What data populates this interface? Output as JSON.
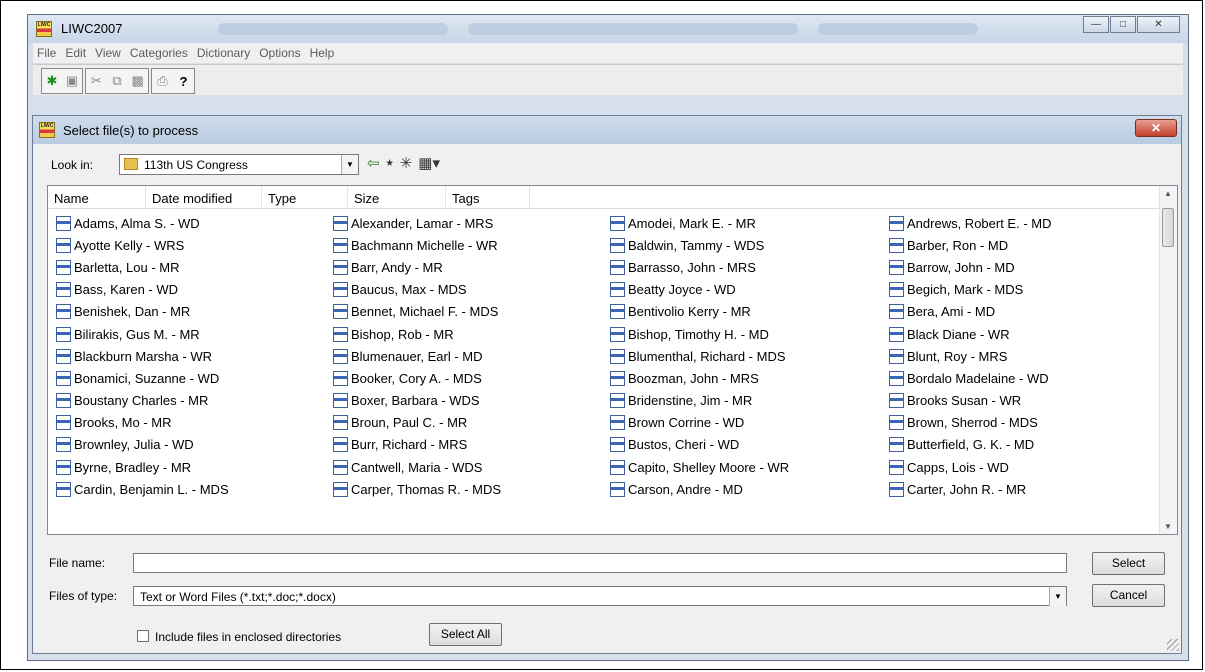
{
  "window": {
    "title": "LIWC2007"
  },
  "menu": [
    "File",
    "Edit",
    "View",
    "Categories",
    "Dictionary",
    "Options",
    "Help"
  ],
  "dialog": {
    "title": "Select file(s) to process",
    "look_in_label": "Look in:",
    "look_in_value": "113th US Congress",
    "columns": [
      "Name",
      "Date modified",
      "Type",
      "Size",
      "Tags"
    ],
    "files_columns": [
      [
        "Adams, Alma S. - WD",
        "Ayotte Kelly - WRS",
        "Barletta, Lou - MR",
        "Bass, Karen  - WD",
        "Benishek, Dan - MR",
        "Bilirakis, Gus M. - MR",
        "Blackburn Marsha - WR",
        "Bonamici, Suzanne  - WD",
        "Boustany Charles - MR",
        "Brooks, Mo - MR",
        "Brownley, Julia - WD",
        "Byrne, Bradley - MR",
        "Cardin, Benjamin L. - MDS"
      ],
      [
        "Alexander, Lamar - MRS",
        "Bachmann Michelle - WR",
        "Barr, Andy - MR",
        "Baucus, Max - MDS",
        "Bennet, Michael F. - MDS",
        "Bishop, Rob - MR",
        "Blumenauer, Earl - MD",
        "Booker, Cory A. - MDS",
        "Boxer, Barbara - WDS",
        "Broun, Paul C. - MR",
        "Burr, Richard - MRS",
        "Cantwell, Maria - WDS",
        "Carper, Thomas R. - MDS"
      ],
      [
        "Amodei, Mark E. - MR",
        "Baldwin, Tammy - WDS",
        "Barrasso, John - MRS",
        "Beatty Joyce - WD",
        "Bentivolio Kerry - MR",
        "Bishop, Timothy H. - MD",
        "Blumenthal, Richard - MDS",
        "Boozman, John - MRS",
        "Bridenstine, Jim - MR",
        "Brown Corrine - WD",
        "Bustos, Cheri - WD",
        "Capito, Shelley Moore - WR",
        "Carson, Andre - MD"
      ],
      [
        "Andrews, Robert E. - MD",
        "Barber, Ron - MD",
        "Barrow, John - MD",
        "Begich, Mark - MDS",
        "Bera, Ami - MD",
        "Black Diane - WR",
        "Blunt, Roy - MRS",
        "Bordalo Madelaine - WD",
        "Brooks Susan - WR",
        "Brown, Sherrod - MDS",
        "Butterfield, G. K. - MD",
        "Capps, Lois  - WD",
        "Carter, John R. - MR"
      ]
    ],
    "file_name_label": "File name:",
    "file_name_value": "",
    "files_of_type_label": "Files of type:",
    "files_of_type_value": "Text or Word Files (*.txt;*.doc;*.docx)",
    "include_label": "Include files in enclosed directories",
    "select_all_label": "Select All",
    "select_label": "Select",
    "cancel_label": "Cancel"
  }
}
